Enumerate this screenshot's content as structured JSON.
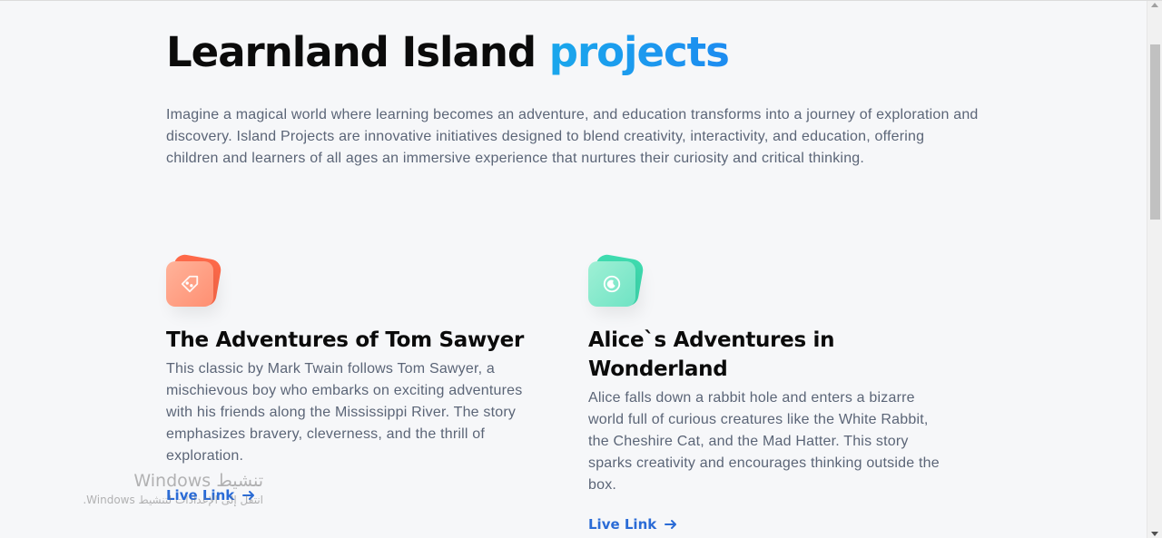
{
  "heading": {
    "main": "Learnland Island",
    "accent": "projects"
  },
  "intro": "Imagine a magical world where learning becomes an adventure, and education transforms into a journey of exploration and discovery. Island Projects are innovative initiatives designed to blend creativity, interactivity, and education, offering children and learners of all ages an immersive experience that nurtures their curiosity and critical thinking.",
  "projects": [
    {
      "title": "The Adventures of Tom Sawyer",
      "description": "This classic by Mark Twain follows Tom Sawyer, a mischievous boy who embarks on exciting adventures with his friends along the Mississippi River. The story emphasizes bravery, cleverness, and the thrill of exploration.",
      "link_label": "Live Link",
      "icon": "tag-icon"
    },
    {
      "title": "Alice`s Adventures in Wonderland",
      "description": "Alice falls down a rabbit hole and enters a bizarre world full of curious creatures like the White Rabbit, the Cheshire Cat, and the Mad Hatter. This story sparks creativity and encourages thinking outside the box.",
      "link_label": "Live Link",
      "icon": "moon-circle-icon"
    }
  ],
  "watermark": {
    "line1": "تنشيط Windows",
    "line2": "انتقل إلى الإعدادات لتنشيط Windows."
  },
  "colors": {
    "accent": "#1aa7ec",
    "link": "#2a6bd6",
    "text_muted": "#5b6577",
    "background": "#f6f7f9"
  }
}
